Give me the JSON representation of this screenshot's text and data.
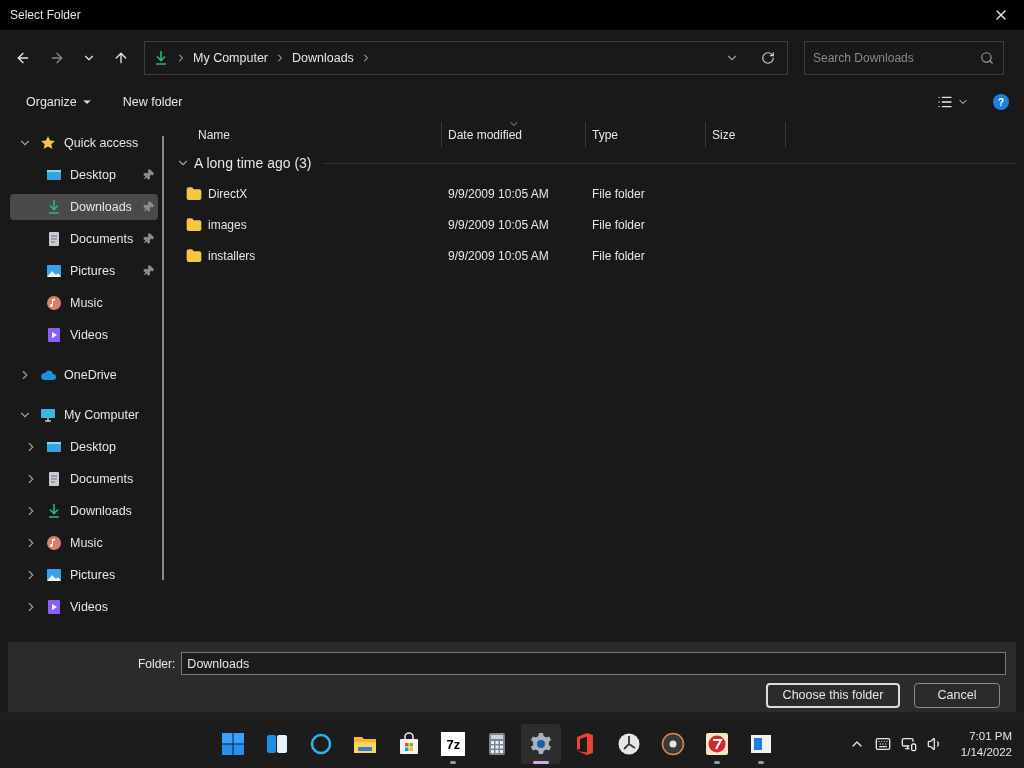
{
  "window": {
    "title": "Select Folder"
  },
  "address": {
    "segments": [
      "My Computer",
      "Downloads"
    ]
  },
  "search": {
    "placeholder": "Search Downloads"
  },
  "toolbar": {
    "organize": "Organize",
    "new_folder": "New folder",
    "help": "?"
  },
  "sidebar": {
    "groups": [
      {
        "label": "Quick access",
        "kind": "star",
        "expanded": true,
        "selected": false,
        "children": [
          {
            "label": "Desktop",
            "kind": "desktop",
            "pinned": true,
            "selected": false
          },
          {
            "label": "Downloads",
            "kind": "downloads",
            "pinned": true,
            "selected": true
          },
          {
            "label": "Documents",
            "kind": "documents",
            "pinned": true,
            "selected": false
          },
          {
            "label": "Pictures",
            "kind": "pictures",
            "pinned": true,
            "selected": false
          },
          {
            "label": "Music",
            "kind": "music",
            "pinned": false,
            "selected": false
          },
          {
            "label": "Videos",
            "kind": "videos",
            "pinned": false,
            "selected": false
          }
        ]
      },
      {
        "label": "OneDrive",
        "kind": "cloud",
        "expanded": false,
        "selected": false
      },
      {
        "label": "My Computer",
        "kind": "computer",
        "expanded": true,
        "selected": false,
        "children": [
          {
            "label": "Desktop",
            "kind": "desktop",
            "expanded": false,
            "selected": false
          },
          {
            "label": "Documents",
            "kind": "documents",
            "expanded": false,
            "selected": false
          },
          {
            "label": "Downloads",
            "kind": "downloads",
            "expanded": false,
            "selected": false
          },
          {
            "label": "Music",
            "kind": "music",
            "expanded": false,
            "selected": false
          },
          {
            "label": "Pictures",
            "kind": "pictures",
            "expanded": false,
            "selected": false
          },
          {
            "label": "Videos",
            "kind": "videos",
            "expanded": false,
            "selected": false
          }
        ]
      }
    ]
  },
  "table": {
    "columns": [
      {
        "label": "Name",
        "sorted": false
      },
      {
        "label": "Date modified",
        "sorted": true
      },
      {
        "label": "Type",
        "sorted": false
      },
      {
        "label": "Size",
        "sorted": false
      }
    ],
    "group": {
      "label": "A long time ago (3)",
      "expanded": true
    },
    "rows": [
      {
        "name": "DirectX",
        "date": "9/9/2009 10:05 AM",
        "type": "File folder"
      },
      {
        "name": "images",
        "date": "9/9/2009 10:05 AM",
        "type": "File folder"
      },
      {
        "name": "installers",
        "date": "9/9/2009 10:05 AM",
        "type": "File folder"
      }
    ]
  },
  "footer": {
    "label": "Folder:",
    "value": "Downloads",
    "buttons": [
      {
        "label": "Choose this folder",
        "default": true
      },
      {
        "label": "Cancel",
        "default": false
      }
    ]
  },
  "taskbar": {
    "apps": [
      {
        "kind": "start",
        "running": false,
        "active": false
      },
      {
        "kind": "widgets",
        "running": false,
        "active": false
      },
      {
        "kind": "ring",
        "running": false,
        "active": false
      },
      {
        "kind": "explorer",
        "running": false,
        "active": false
      },
      {
        "kind": "store",
        "running": false,
        "active": false
      },
      {
        "kind": "archiver",
        "text": "7z",
        "running": true,
        "active": false
      },
      {
        "kind": "calculator",
        "running": false,
        "active": false
      },
      {
        "kind": "settings",
        "running": true,
        "active": true
      },
      {
        "kind": "office",
        "running": false,
        "active": false
      },
      {
        "kind": "clock",
        "running": false,
        "active": false
      },
      {
        "kind": "disc",
        "running": false,
        "active": false
      },
      {
        "kind": "redapp",
        "running": true,
        "active": false
      },
      {
        "kind": "blueapp",
        "running": true,
        "active": false
      }
    ],
    "time": "7:01 PM",
    "date": "1/14/2022"
  }
}
